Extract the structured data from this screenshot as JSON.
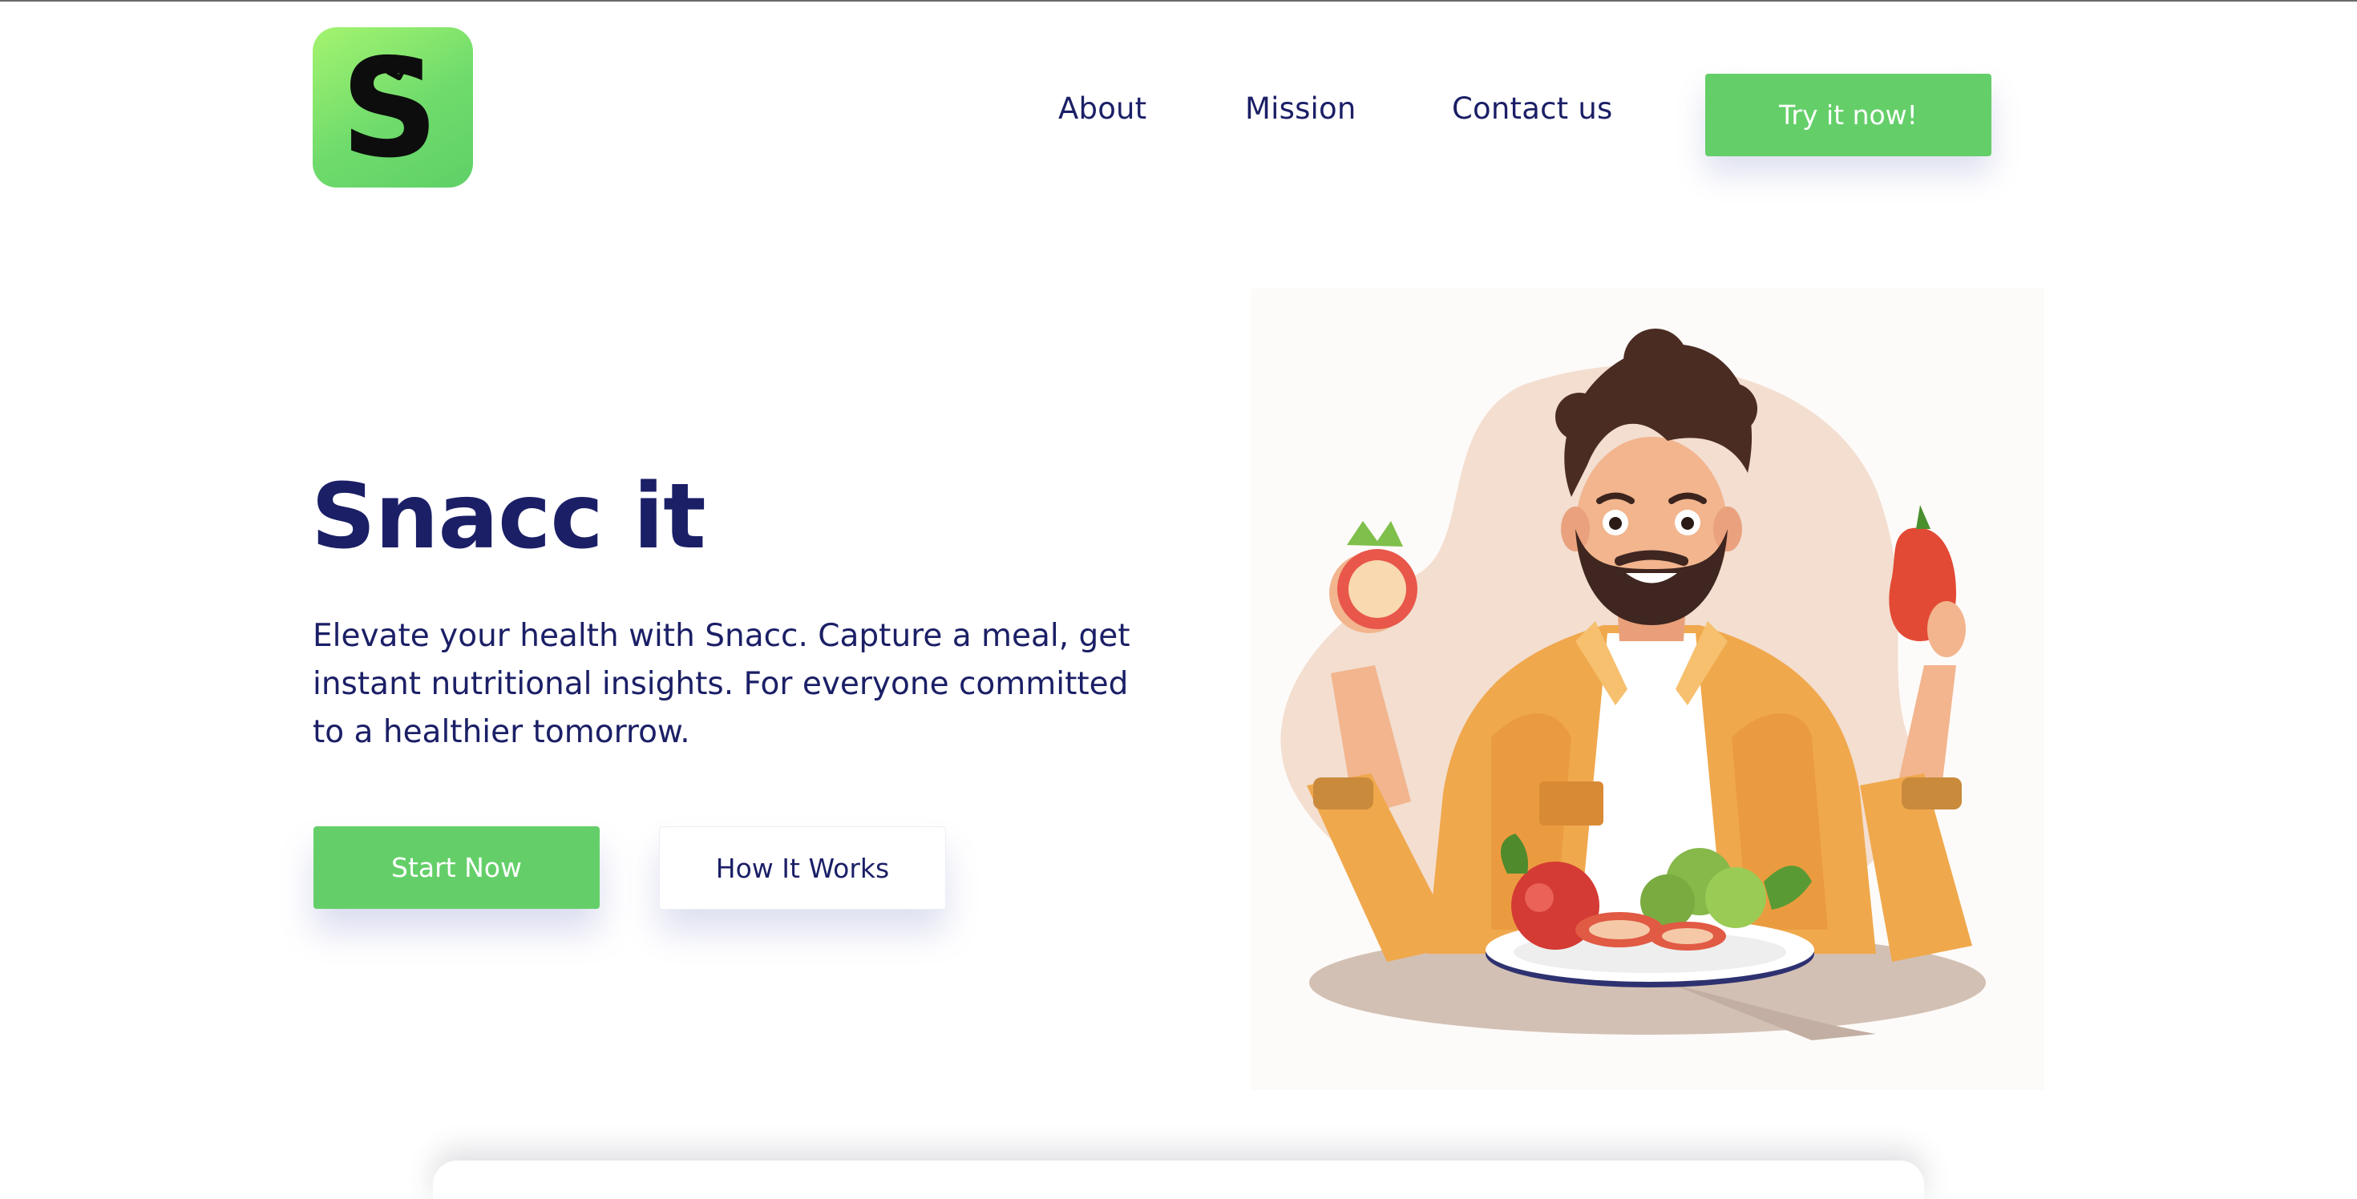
{
  "logo": {
    "letter": "S",
    "icon": "fork-icon",
    "gradient": [
      "#a4f46f",
      "#5fd067"
    ]
  },
  "nav": {
    "about": "About",
    "mission": "Mission",
    "contact": "Contact us",
    "cta": "Try it now!"
  },
  "hero": {
    "title": "Snacc it",
    "description": "Elevate your health with Snacc. Capture a meal, get instant nutritional insights. For everyone committed to a healthier tomorrow.",
    "primary_button": "Start Now",
    "secondary_button": "How It Works"
  },
  "colors": {
    "primary_green": "#64cf69",
    "navy_text": "#1b1f66",
    "background": "#ffffff"
  }
}
